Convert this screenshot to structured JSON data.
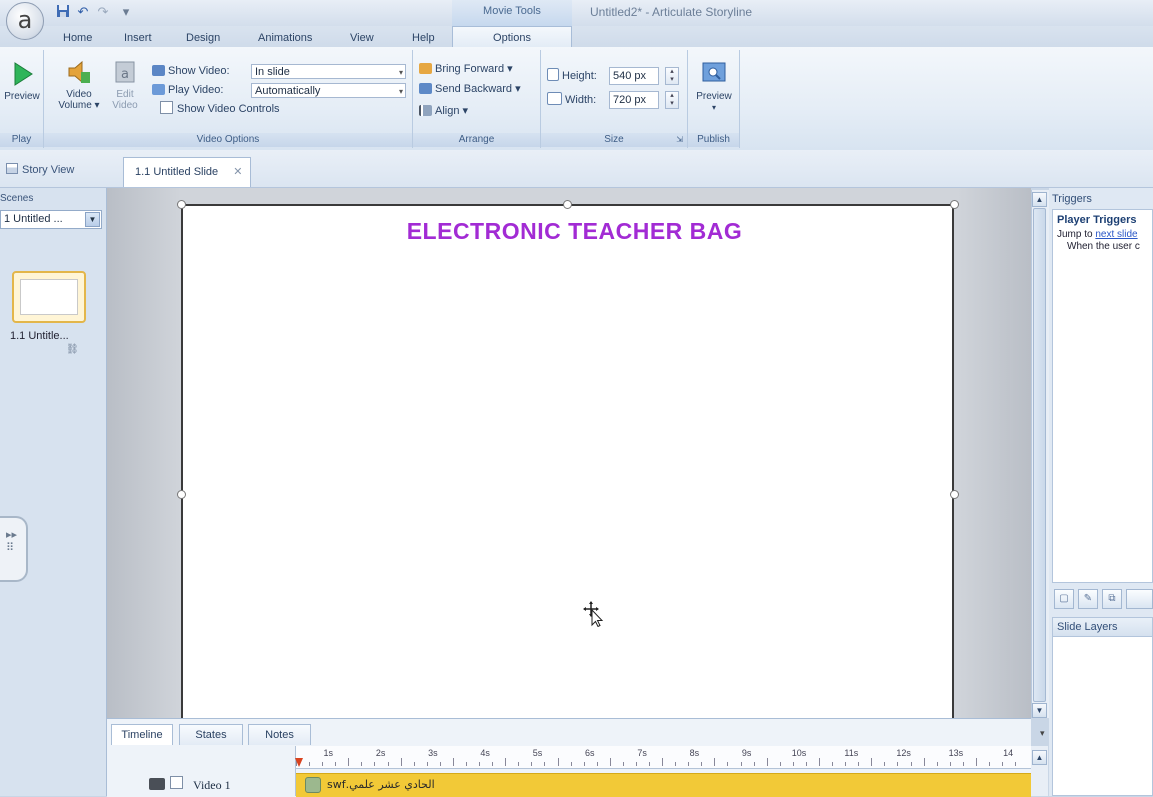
{
  "app": {
    "logo": "a",
    "window_title": "Untitled2* - Articulate Storyline",
    "context_tab_group": "Movie Tools"
  },
  "quick_access": [
    {
      "icon": "save-icon",
      "glyph": "💾"
    },
    {
      "icon": "undo-icon",
      "glyph": "↶"
    },
    {
      "icon": "redo-icon",
      "glyph": "↷"
    },
    {
      "icon": "customize-icon",
      "glyph": "="
    }
  ],
  "ribbon_tabs": [
    "Home",
    "Insert",
    "Design",
    "Animations",
    "View",
    "Help",
    "Options"
  ],
  "ribbon": {
    "play": {
      "preview_label": "Preview",
      "group_label": "Play"
    },
    "video_options": {
      "volume_label": "Video Volume ▾",
      "edit_label": "Edit Video",
      "show_video_label": "Show Video:",
      "show_video_value": "In slide",
      "play_video_label": "Play Video:",
      "play_video_value": "Automatically",
      "show_controls_label": "Show Video Controls",
      "show_controls_checked": false,
      "group_label": "Video Options"
    },
    "arrange": {
      "bring_forward": "Bring Forward ▾",
      "send_backward": "Send Backward ▾",
      "align": "Align ▾",
      "group_label": "Arrange"
    },
    "size": {
      "height_label": "Height:",
      "height_value": "540 px",
      "width_label": "Width:",
      "width_value": "720 px",
      "group_label": "Size"
    },
    "publish": {
      "preview_label": "Preview",
      "group_label": "Publish"
    }
  },
  "doc_tabs": {
    "story_view": "Story View",
    "active_slide": "1.1 Untitled Slide",
    "close_glyph": "✕"
  },
  "scenes": {
    "header": "Scenes",
    "selected": "1 Untitled ...",
    "thumbnail_label": "1.1  Untitle..."
  },
  "slide": {
    "title_text": "ELECTRONIC TEACHER BAG",
    "title_color": "#a22bd4"
  },
  "triggers": {
    "header": "Triggers",
    "player_triggers": "Player Triggers",
    "line1_prefix": "Jump to ",
    "line1_link": "next slide",
    "line2": "When the user c"
  },
  "slide_layers": {
    "header": "Slide Layers"
  },
  "timeline": {
    "tabs": [
      "Timeline",
      "States",
      "Notes"
    ],
    "ruler_labels": [
      "1s",
      "2s",
      "3s",
      "4s",
      "5s",
      "6s",
      "7s",
      "8s",
      "9s",
      "10s",
      "11s",
      "12s",
      "13s",
      "14"
    ],
    "track_label": "Video 1",
    "track_media_name": "الحادي عشر علمي.swf",
    "track_color": "#f2c937"
  }
}
